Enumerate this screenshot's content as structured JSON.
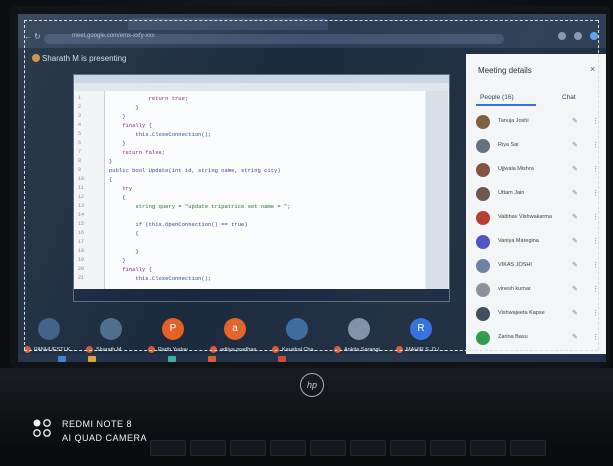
{
  "browser": {
    "address_text": "meet.google.com/ems-xxfy-xxx"
  },
  "meet": {
    "presenting_label": "Sharath M is presenting",
    "panel_title": "Meeting details",
    "tab_people": "People (16)",
    "tab_chat": "Chat",
    "participants": [
      {
        "name": "Tanuja Joshi",
        "color": "#7a5a3c"
      },
      {
        "name": "Riya Sai",
        "color": "#5f6b7a"
      },
      {
        "name": "Ujjwala Mishra",
        "color": "#7c4f3a"
      },
      {
        "name": "Uttam Jain",
        "color": "#6a5048"
      },
      {
        "name": "Vaibhav Vishwakarma",
        "color": "#b23a2c"
      },
      {
        "name": "Vaniya Maregina",
        "color": "#4b4fc2"
      },
      {
        "name": "VIKAS JOSHI",
        "color": "#6b7ea0"
      },
      {
        "name": "vinesh kumar",
        "color": "#8a8f97"
      },
      {
        "name": "Vishwajeeta Kapse",
        "color": "#3d4a5a"
      },
      {
        "name": "Zarina Basu",
        "color": "#2f9a4c"
      }
    ],
    "tiles": [
      {
        "label": "PANHUESTI K...",
        "initial": "",
        "color": "#3b5f86"
      },
      {
        "label": "Sharath M",
        "initial": "",
        "color": "#4d6d8c"
      },
      {
        "label": "Parth Yadav",
        "initial": "P",
        "color": "#e3622a"
      },
      {
        "label": "aditya pradhan",
        "initial": "a",
        "color": "#e3622a"
      },
      {
        "label": "Kaushal Cha...",
        "initial": "",
        "color": "#3a6aa0"
      },
      {
        "label": "Ankita Sarangi",
        "initial": "",
        "color": "#7e8fa6"
      },
      {
        "label": "MAHIR S. D / ...",
        "initial": "R",
        "color": "#2f6ee0"
      }
    ]
  },
  "code": {
    "lines": [
      {
        "text": "            return true;",
        "type": "kw"
      },
      {
        "text": "        }",
        "type": "plain"
      },
      {
        "text": "    }",
        "type": "plain"
      },
      {
        "text": "    finally {",
        "type": "kw"
      },
      {
        "text": "        this.CloseConnection();",
        "type": "plain"
      },
      {
        "text": "    }",
        "type": "plain"
      },
      {
        "text": "    return false;",
        "type": "kw"
      },
      {
        "text": "}",
        "type": "plain"
      },
      {
        "text": "public bool Update(int id, string name, string city)",
        "type": "plain"
      },
      {
        "text": "{",
        "type": "plain"
      },
      {
        "text": "    try",
        "type": "kw"
      },
      {
        "text": "    {",
        "type": "plain"
      },
      {
        "text": "        string query = \"update tripatrice set name = \";",
        "type": "str"
      },
      {
        "text": "",
        "type": "plain"
      },
      {
        "text": "        if (this.OpenConnection() == true)",
        "type": "plain"
      },
      {
        "text": "        {",
        "type": "plain"
      },
      {
        "text": "",
        "type": "plain"
      },
      {
        "text": "        }",
        "type": "plain"
      },
      {
        "text": "    }",
        "type": "plain"
      },
      {
        "text": "    finally {",
        "type": "kw"
      },
      {
        "text": "        this.CloseConnection();",
        "type": "plain"
      }
    ]
  },
  "laptop": {
    "brand_mark": "hp"
  },
  "camera_stamp": {
    "line1": "REDMI NOTE 8",
    "line2": "AI QUAD CAMERA"
  }
}
